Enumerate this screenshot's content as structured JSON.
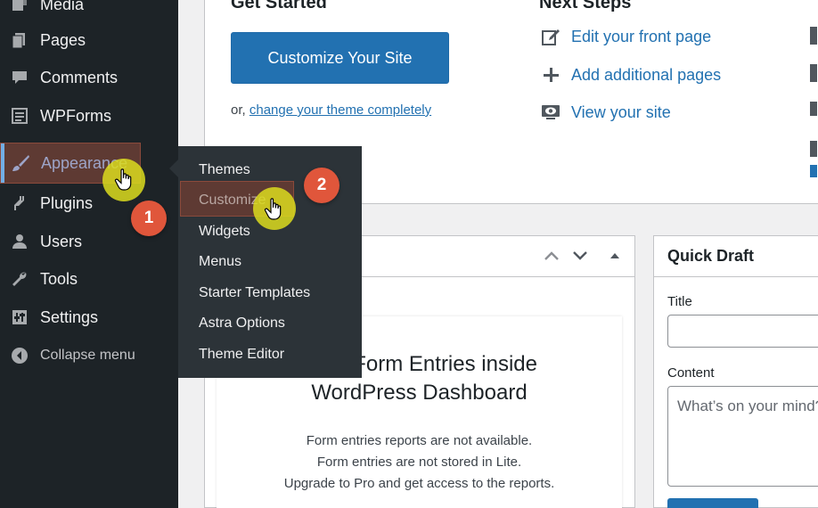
{
  "sidebar": {
    "items": [
      {
        "label": "Media",
        "icon": "media-icon"
      },
      {
        "label": "Pages",
        "icon": "pages-icon"
      },
      {
        "label": "Comments",
        "icon": "comments-icon"
      },
      {
        "label": "WPForms",
        "icon": "wpforms-icon"
      },
      {
        "label": "Appearance",
        "icon": "paintbrush-icon"
      },
      {
        "label": "Plugins",
        "icon": "plugin-icon"
      },
      {
        "label": "Users",
        "icon": "user-icon"
      },
      {
        "label": "Tools",
        "icon": "wrench-icon"
      },
      {
        "label": "Settings",
        "icon": "settings-icon"
      }
    ],
    "collapse_label": "Collapse menu"
  },
  "submenu": {
    "items": [
      "Themes",
      "Customize",
      "Widgets",
      "Menus",
      "Starter Templates",
      "Astra Options",
      "Theme Editor"
    ]
  },
  "welcome": {
    "get_started_title": "Get Started",
    "customize_button": "Customize Your Site",
    "or_text": "or,",
    "change_theme_link": "change your theme completely",
    "next_steps_title": "Next Steps",
    "steps": [
      {
        "label": "Edit your front page",
        "icon": "edit-icon"
      },
      {
        "label": "Add additional pages",
        "icon": "plus-icon"
      },
      {
        "label": "View your site",
        "icon": "view-icon"
      }
    ]
  },
  "wpforms_widget": {
    "heading_line1": "View Form Entries inside",
    "heading_line2": "WordPress Dashboard",
    "lines": [
      "Form entries reports are not available.",
      "Form entries are not stored in Lite.",
      "Upgrade to Pro and get access to the reports."
    ]
  },
  "quick_draft": {
    "title": "Quick Draft",
    "title_label": "Title",
    "content_label": "Content",
    "content_placeholder": "What’s on your mind?"
  },
  "annotations": {
    "badge1": "1",
    "badge2": "2"
  },
  "colors": {
    "sidebar_bg": "#1d2327",
    "submenu_bg": "#2c3338",
    "primary_blue": "#2271b1",
    "highlight_brown": "#5e3a33",
    "badge_orange": "#e0563b",
    "cursor_yellow": "#dcdc1e"
  }
}
